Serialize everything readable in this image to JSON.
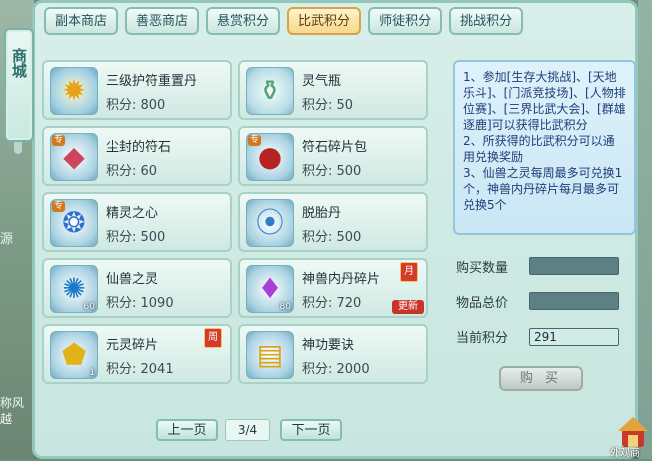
{
  "side_tab": {
    "label": "商城"
  },
  "background": {
    "left_text": "源",
    "left_text2": "称风越"
  },
  "tabs": [
    {
      "label": "副本商店",
      "active": false
    },
    {
      "label": "善恶商店",
      "active": false
    },
    {
      "label": "悬赏积分",
      "active": false
    },
    {
      "label": "比武积分",
      "active": true
    },
    {
      "label": "师徒积分",
      "active": false
    },
    {
      "label": "挑战积分",
      "active": false
    }
  ],
  "items": [
    {
      "name": "三级护符重置丹",
      "price": "积分: 800",
      "icon": "golden-pill-icon",
      "count": "",
      "tag": "",
      "badge": "",
      "new": ""
    },
    {
      "name": "灵气瓶",
      "price": "积分: 50",
      "icon": "jade-vase-icon",
      "count": "",
      "tag": "",
      "badge": "",
      "new": ""
    },
    {
      "name": "尘封的符石",
      "price": "积分: 60",
      "icon": "gem-rock-icon",
      "count": "",
      "tag": "专",
      "badge": "",
      "new": ""
    },
    {
      "name": "符石碎片包",
      "price": "积分: 500",
      "icon": "red-pouch-icon",
      "count": "",
      "tag": "专",
      "badge": "",
      "new": ""
    },
    {
      "name": "精灵之心",
      "price": "积分: 500",
      "icon": "spirit-heart-icon",
      "count": "",
      "tag": "专",
      "badge": "",
      "new": ""
    },
    {
      "name": "脱胎丹",
      "price": "积分: 500",
      "icon": "blue-pills-icon",
      "count": "",
      "tag": "",
      "badge": "",
      "new": ""
    },
    {
      "name": "仙兽之灵",
      "price": "积分: 1090",
      "icon": "blue-orb-icon",
      "count": "60",
      "tag": "",
      "badge": "",
      "new": ""
    },
    {
      "name": "神兽内丹碎片",
      "price": "积分: 720",
      "icon": "purple-crystal-icon",
      "count": "80",
      "tag": "",
      "badge": "月",
      "new": "更新"
    },
    {
      "name": "元灵碎片",
      "price": "积分: 2041",
      "icon": "gold-shard-icon",
      "count": "1",
      "tag": "",
      "badge": "周",
      "new": ""
    },
    {
      "name": "神功要诀",
      "price": "积分: 2000",
      "icon": "gold-book-icon",
      "count": "",
      "tag": "",
      "badge": "",
      "new": ""
    }
  ],
  "info": {
    "text": "1、参加[生存大挑战]、[天地乐斗]、[门派竞技场]、[人物排位赛]、[三界比武大会]、[群雄逐鹿]可以获得比武积分\n2、所获得的比武积分可以通用兑换奖励\n3、仙兽之灵每周最多可兑换1个，神兽内丹碎片每月最多可兑换5个"
  },
  "form": {
    "qty_label": "购买数量",
    "qty_value": "",
    "total_label": "物品总价",
    "total_value": "",
    "points_label": "当前积分",
    "points_value": "291",
    "buy_label": "购 买"
  },
  "pager": {
    "prev": "上一页",
    "page": "3/4",
    "next": "下一页"
  },
  "corner": {
    "label": "外观商"
  }
}
